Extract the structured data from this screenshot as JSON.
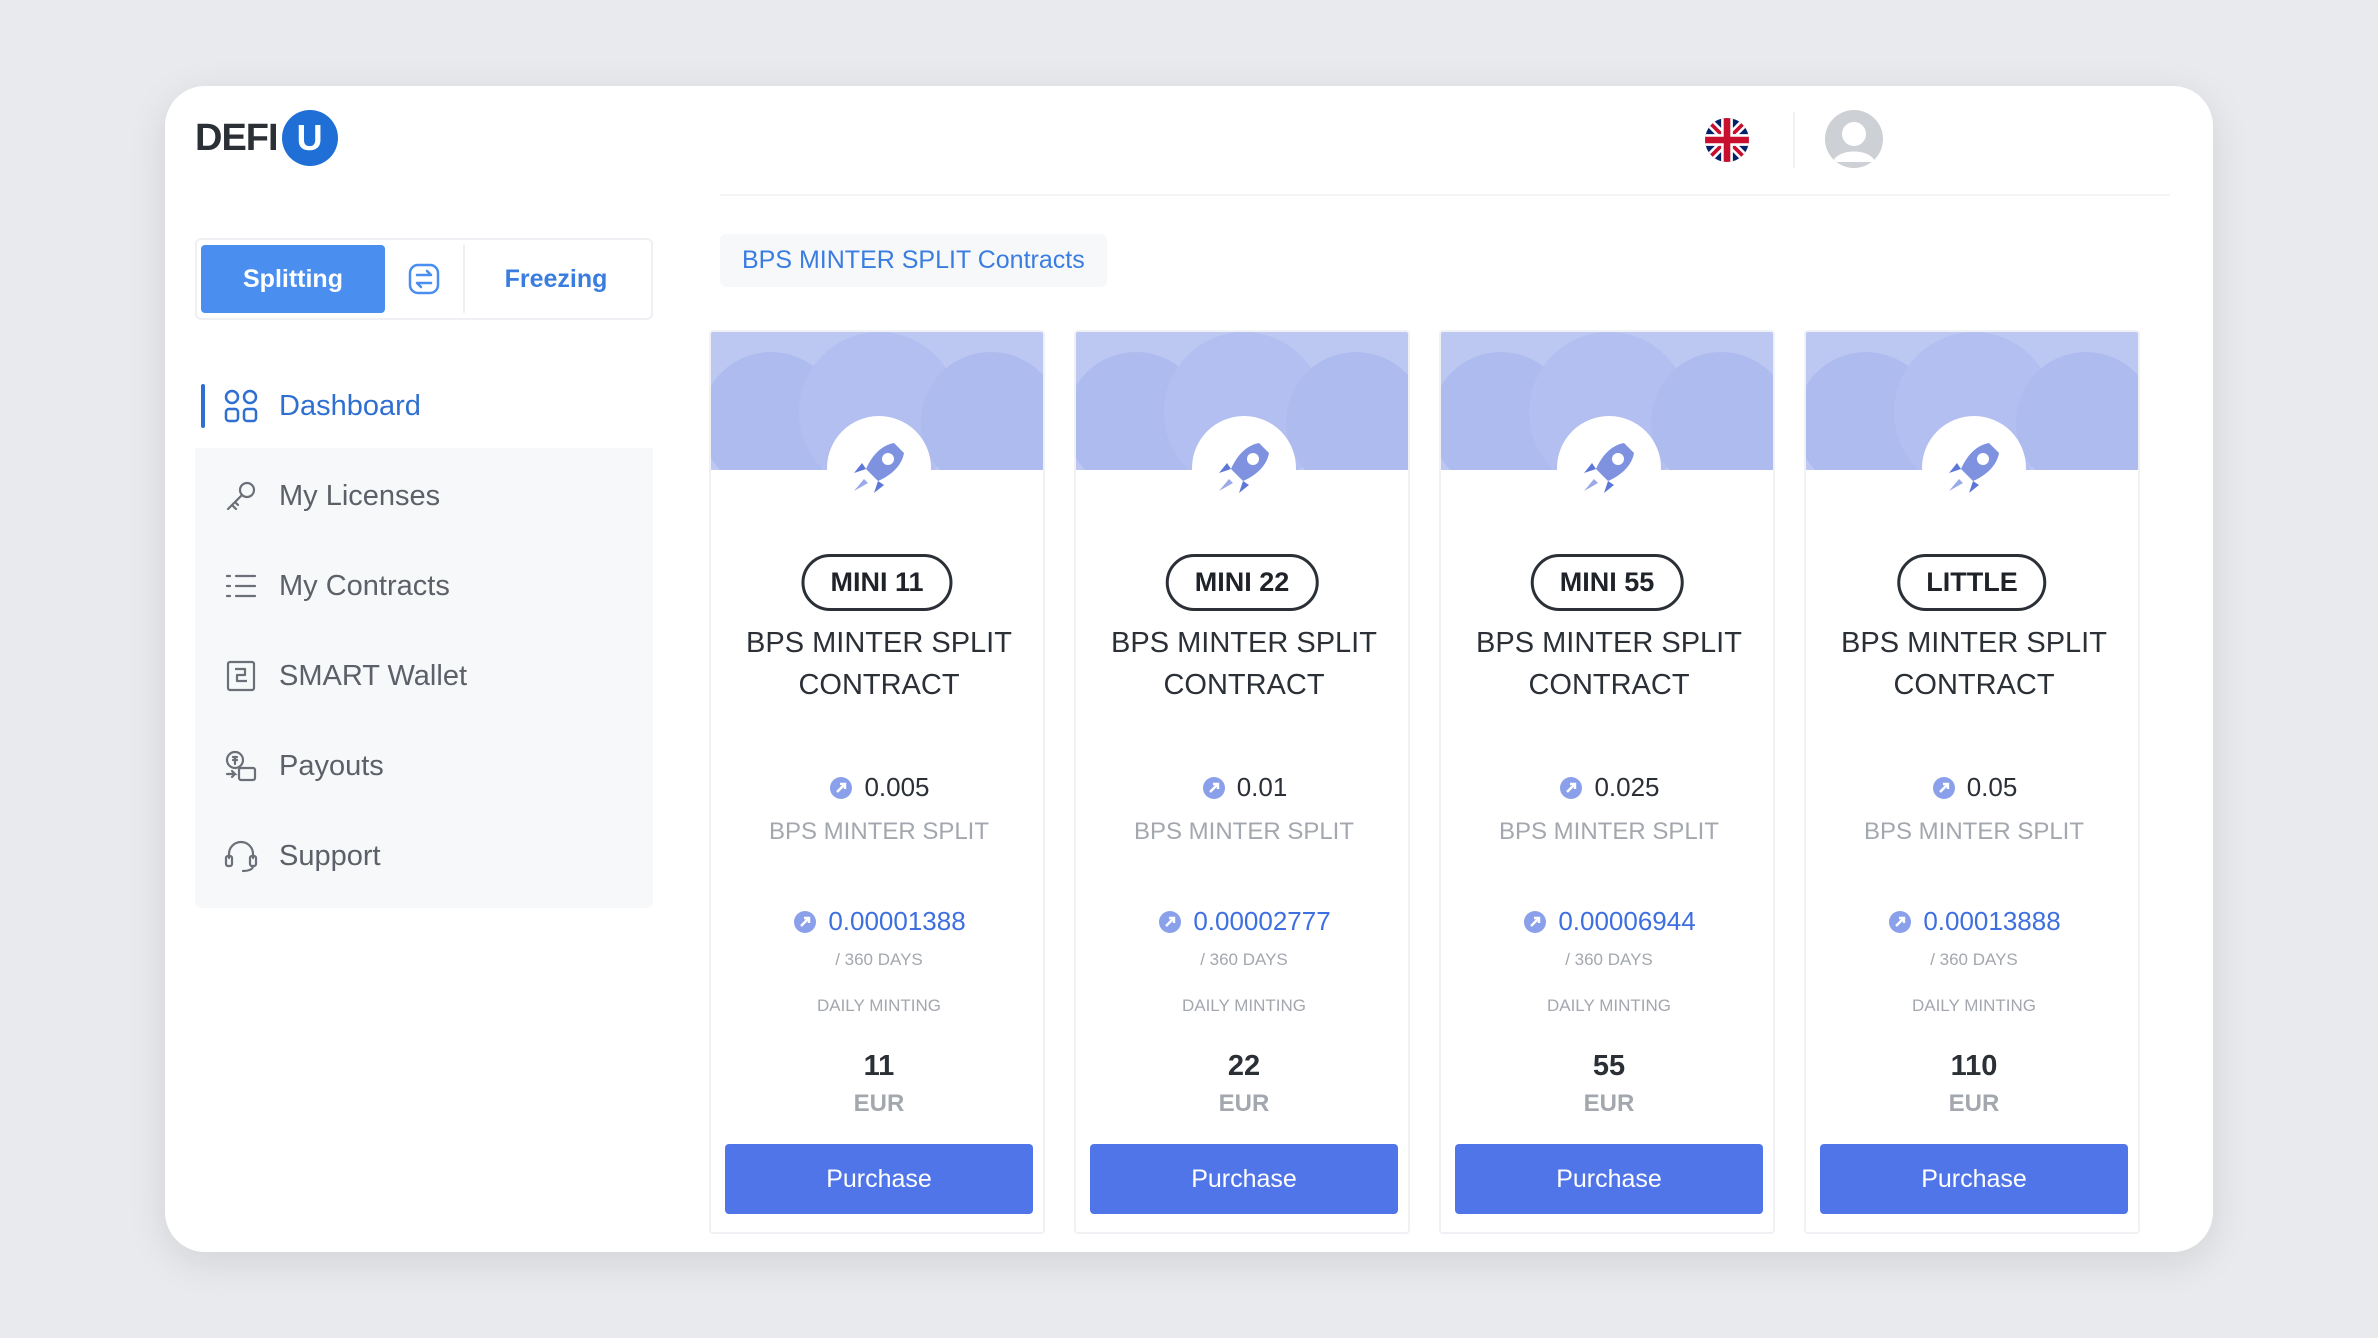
{
  "brand": {
    "name": "DEFI",
    "badge": "U",
    "accent": "#1f6fd6"
  },
  "header": {
    "language_icon": "uk-flag-icon",
    "avatar_icon": "user-avatar-icon"
  },
  "toggle": {
    "splitting_label": "Splitting",
    "freezing_label": "Freezing",
    "swap_icon": "swap-icon"
  },
  "sidebar": {
    "items": [
      {
        "label": "Dashboard",
        "icon": "grid-icon",
        "active": true
      },
      {
        "label": "My Licenses",
        "icon": "key-icon",
        "active": false
      },
      {
        "label": "My Contracts",
        "icon": "list-icon",
        "active": false
      },
      {
        "label": "SMART Wallet",
        "icon": "wallet-icon",
        "active": false
      },
      {
        "label": "Payouts",
        "icon": "payout-icon",
        "active": false
      },
      {
        "label": "Support",
        "icon": "headset-icon",
        "active": false
      }
    ]
  },
  "main": {
    "section_title": "BPS MINTER SPLIT Contracts",
    "cards": [
      {
        "tag": "MINI 11",
        "name_line1": "BPS MINTER SPLIT",
        "name_line2": "CONTRACT",
        "price": "0.005",
        "price_label": "BPS MINTER SPLIT",
        "mint": "0.00001388",
        "period": "/ 360 DAYS",
        "daily": "DAILY MINTING",
        "amount": "11",
        "currency": "EUR",
        "button": "Purchase"
      },
      {
        "tag": "MINI 22",
        "name_line1": "BPS MINTER SPLIT",
        "name_line2": "CONTRACT",
        "price": "0.01",
        "price_label": "BPS MINTER SPLIT",
        "mint": "0.00002777",
        "period": "/ 360 DAYS",
        "daily": "DAILY MINTING",
        "amount": "22",
        "currency": "EUR",
        "button": "Purchase"
      },
      {
        "tag": "MINI 55",
        "name_line1": "BPS MINTER SPLIT",
        "name_line2": "CONTRACT",
        "price": "0.025",
        "price_label": "BPS MINTER SPLIT",
        "mint": "0.00006944",
        "period": "/ 360 DAYS",
        "daily": "DAILY MINTING",
        "amount": "55",
        "currency": "EUR",
        "button": "Purchase"
      },
      {
        "tag": "LITTLE",
        "name_line1": "BPS MINTER SPLIT",
        "name_line2": "CONTRACT",
        "price": "0.05",
        "price_label": "BPS MINTER SPLIT",
        "mint": "0.00013888",
        "period": "/ 360 DAYS",
        "daily": "DAILY MINTING",
        "amount": "110",
        "currency": "EUR",
        "button": "Purchase"
      }
    ]
  },
  "colors": {
    "primary_button": "#4f75e8",
    "active_tab": "#4a8ef0",
    "link": "#3a7de0",
    "banner": "#bcc7f2"
  }
}
